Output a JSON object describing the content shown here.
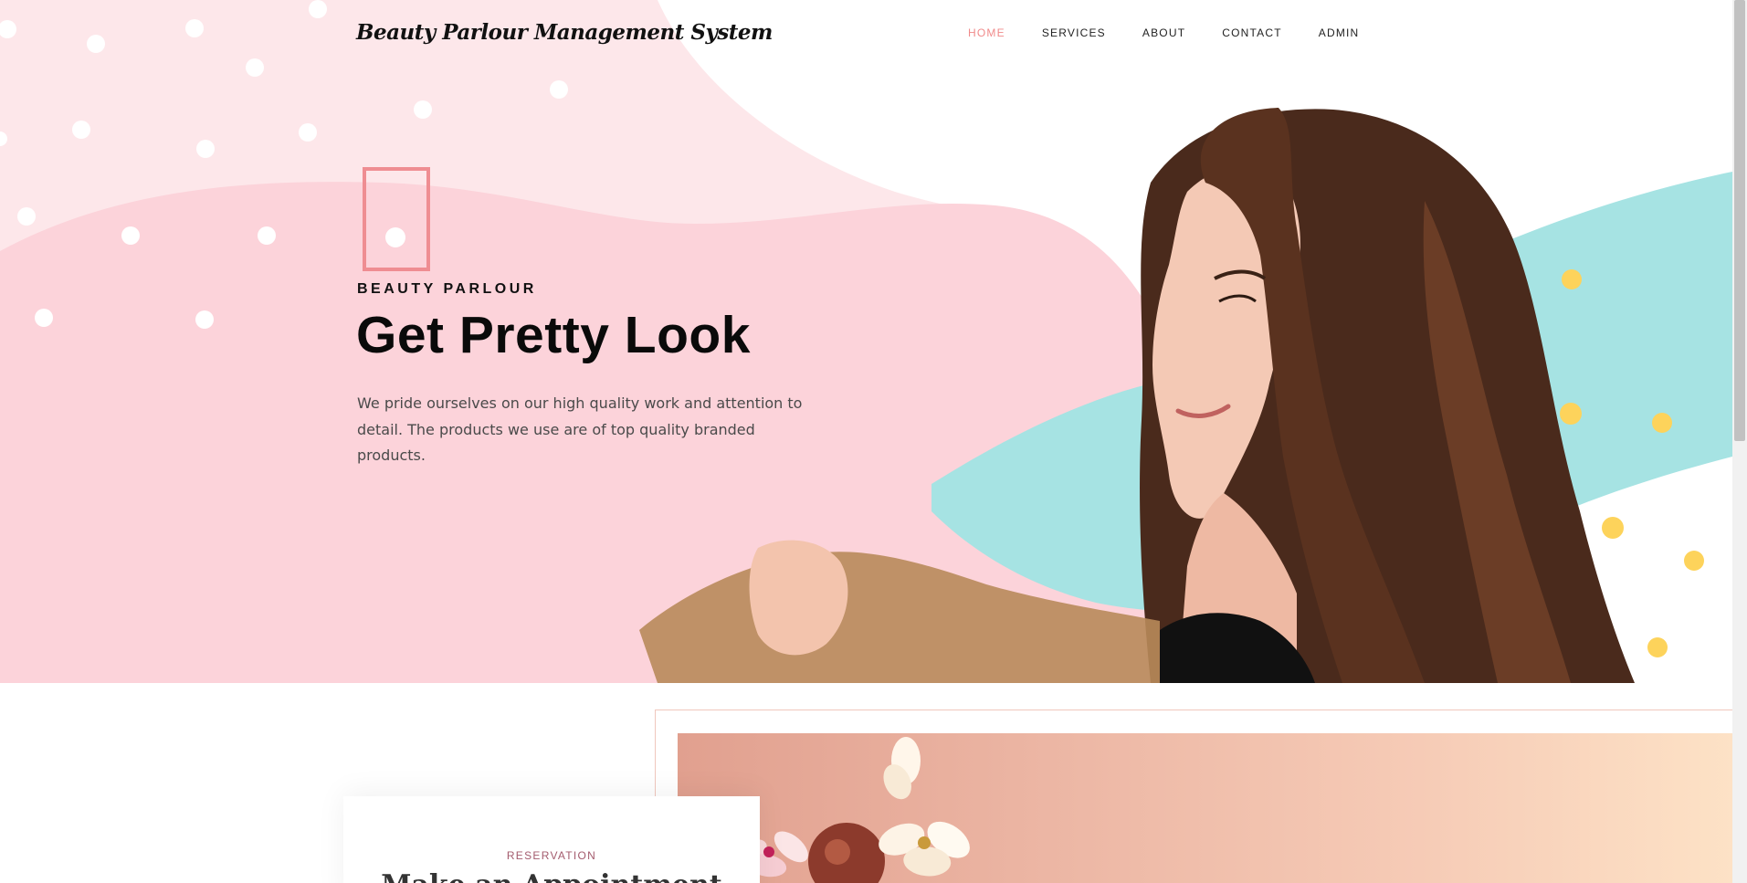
{
  "brand": {
    "name": "Beauty Parlour Management System"
  },
  "nav": {
    "items": [
      {
        "label": "HOME",
        "active": true
      },
      {
        "label": "SERVICES",
        "active": false
      },
      {
        "label": "ABOUT",
        "active": false
      },
      {
        "label": "CONTACT",
        "active": false
      },
      {
        "label": "ADMIN",
        "active": false
      }
    ]
  },
  "hero": {
    "eyebrow": "BEAUTY PARLOUR",
    "title": "Get Pretty Look",
    "description": "We pride ourselves on our high quality work and attention to detail. The products we use are of top quality branded products."
  },
  "reservation": {
    "label": "RESERVATION",
    "heading": "Make an Appointment"
  },
  "colors": {
    "accent": "#f08a8a",
    "hero_pink": "#fcd3da",
    "hero_light_pink": "#fde7ea",
    "brush_teal": "#a6e3e3",
    "dot_yellow": "#fdd35b",
    "label_mauve": "#a45c6e"
  },
  "icons": {
    "hero_frame": "rectangle-outline-icon"
  }
}
